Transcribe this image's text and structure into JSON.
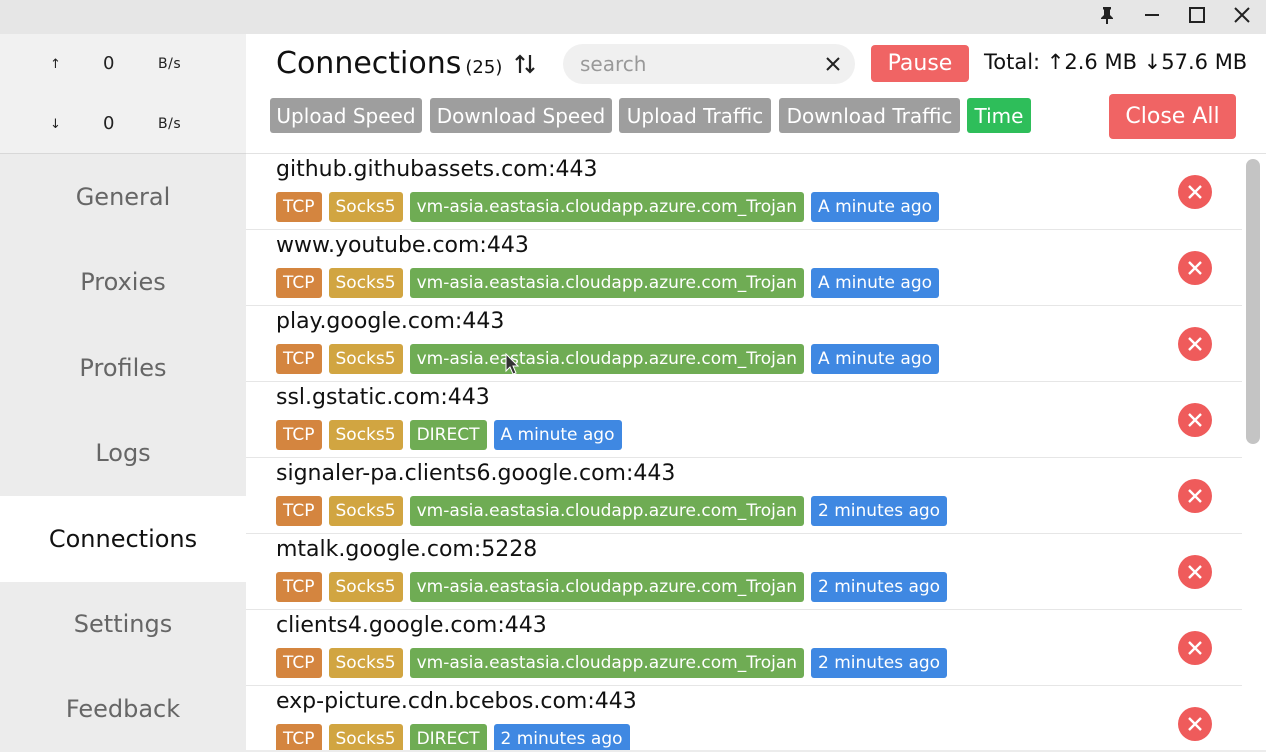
{
  "window": {
    "controls": [
      "pin-icon",
      "minimize-icon",
      "maximize-icon",
      "close-icon"
    ]
  },
  "sidebar": {
    "upload": {
      "arrow": "↑",
      "value": "0",
      "unit": "B/s"
    },
    "download": {
      "arrow": "↓",
      "value": "0",
      "unit": "B/s"
    },
    "nav": [
      {
        "label": "General"
      },
      {
        "label": "Proxies"
      },
      {
        "label": "Profiles"
      },
      {
        "label": "Logs"
      },
      {
        "label": "Connections",
        "active": true
      },
      {
        "label": "Settings"
      },
      {
        "label": "Feedback"
      }
    ]
  },
  "header": {
    "title": "Connections",
    "count": "(25)",
    "search_placeholder": "search",
    "pause_label": "Pause",
    "total_label": "Total: ↑2.6 MB ↓57.6 MB",
    "sort_buttons": [
      {
        "label": "Upload Speed"
      },
      {
        "label": "Download Speed"
      },
      {
        "label": "Upload Traffic"
      },
      {
        "label": "Download Traffic"
      },
      {
        "label": "Time",
        "active": true
      }
    ],
    "close_all_label": "Close All"
  },
  "connections": [
    {
      "host": "github.githubassets.com:443",
      "network": "TCP",
      "type": "Socks5",
      "chain": "vm-asia.eastasia.cloudapp.azure.com_Trojan",
      "time": "A minute ago"
    },
    {
      "host": "www.youtube.com:443",
      "network": "TCP",
      "type": "Socks5",
      "chain": "vm-asia.eastasia.cloudapp.azure.com_Trojan",
      "time": "A minute ago"
    },
    {
      "host": "play.google.com:443",
      "network": "TCP",
      "type": "Socks5",
      "chain": "vm-asia.eastasia.cloudapp.azure.com_Trojan",
      "time": "A minute ago"
    },
    {
      "host": "ssl.gstatic.com:443",
      "network": "TCP",
      "type": "Socks5",
      "chain": "DIRECT",
      "time": "A minute ago"
    },
    {
      "host": "signaler-pa.clients6.google.com:443",
      "network": "TCP",
      "type": "Socks5",
      "chain": "vm-asia.eastasia.cloudapp.azure.com_Trojan",
      "time": "2 minutes ago"
    },
    {
      "host": "mtalk.google.com:5228",
      "network": "TCP",
      "type": "Socks5",
      "chain": "vm-asia.eastasia.cloudapp.azure.com_Trojan",
      "time": "2 minutes ago"
    },
    {
      "host": "clients4.google.com:443",
      "network": "TCP",
      "type": "Socks5",
      "chain": "vm-asia.eastasia.cloudapp.azure.com_Trojan",
      "time": "2 minutes ago"
    },
    {
      "host": "exp-picture.cdn.bcebos.com:443",
      "network": "TCP",
      "type": "Socks5",
      "chain": "DIRECT",
      "time": "2 minutes ago"
    }
  ],
  "colors": {
    "accent_red": "#f06464",
    "active_green": "#2ebe5a",
    "tag_network": "#d4853f",
    "tag_type": "#d1a541",
    "tag_chain": "#6fac54",
    "tag_time": "#3f88e2"
  }
}
